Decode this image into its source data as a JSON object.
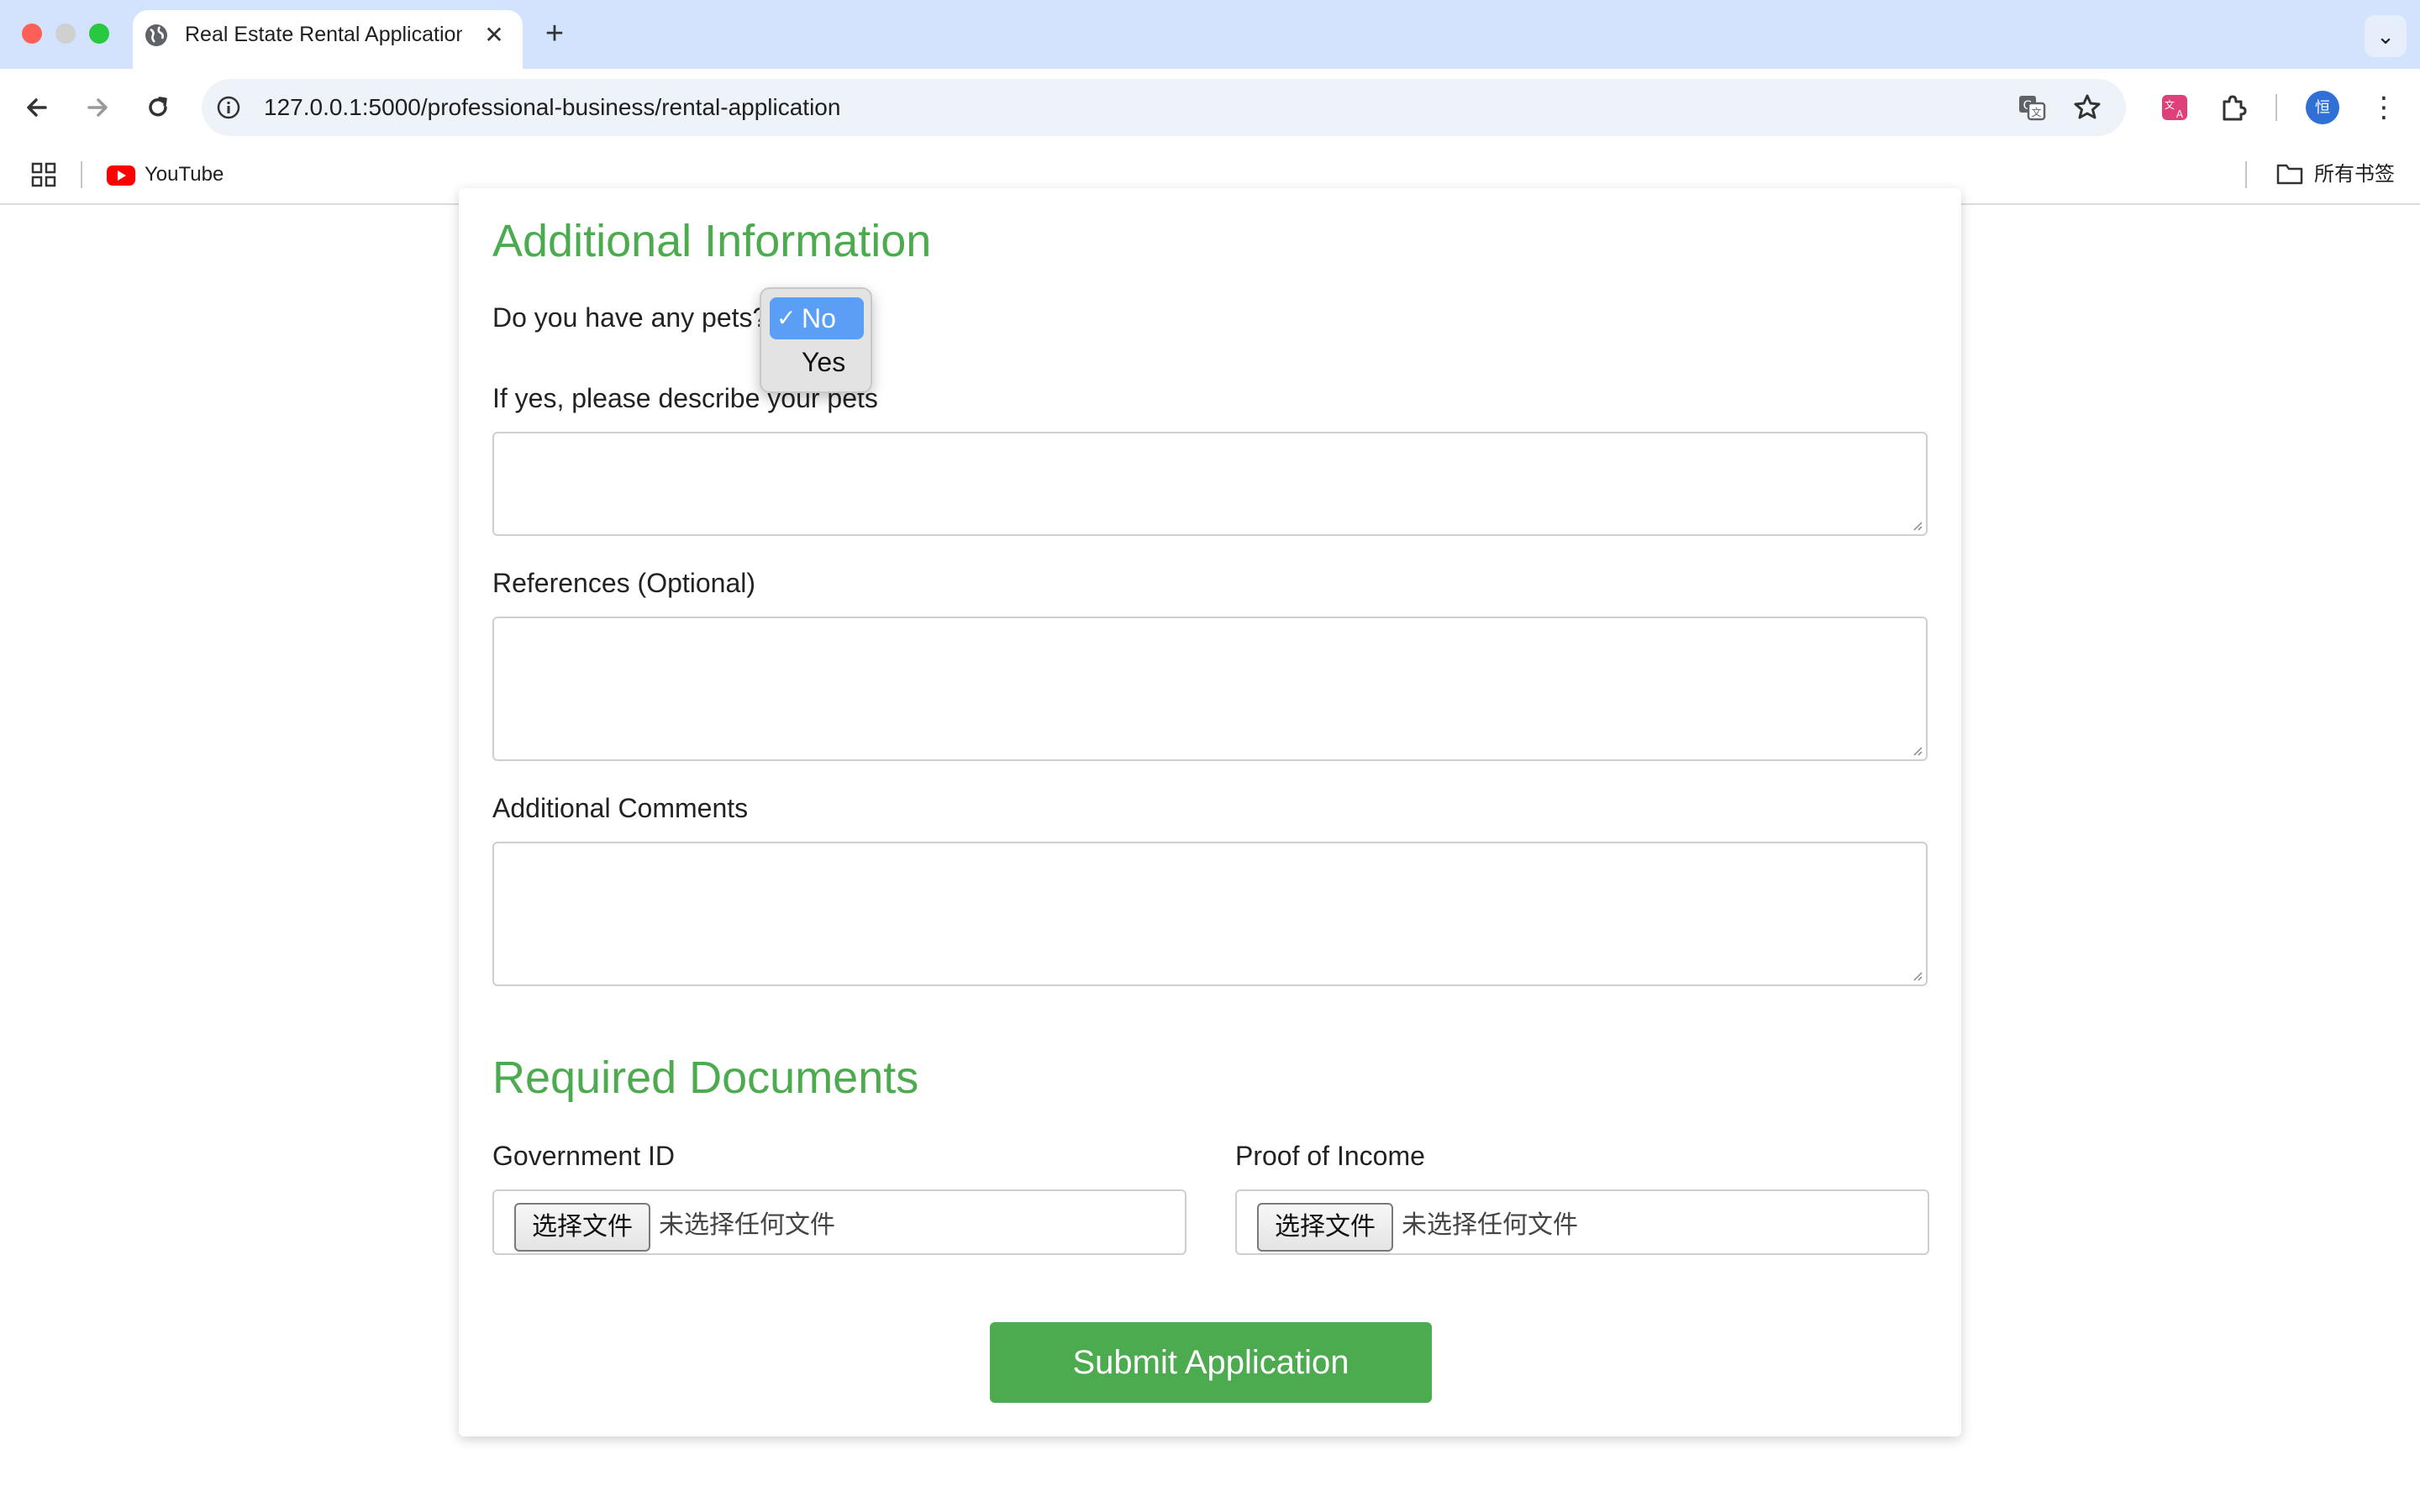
{
  "browser": {
    "tab_title": "Real Estate Rental Application",
    "url": "127.0.0.1:5000/professional-business/rental-application",
    "bookmarks": [
      {
        "label": "YouTube"
      }
    ],
    "all_bookmarks_label": "所有书签",
    "avatar_text": "恒",
    "new_tab_symbol": "+",
    "close_symbol": "✕",
    "menu_symbol": "⌄",
    "kebab_symbol": "⋮"
  },
  "colors": {
    "accent": "#4caa4f",
    "select_highlight": "#5b9ef5"
  },
  "additional_info": {
    "heading": "Additional Information",
    "pets_label": "Do you have any pets?",
    "pets_options": [
      {
        "label": "No",
        "selected": true
      },
      {
        "label": "Yes",
        "selected": false
      }
    ],
    "pets_describe_label": "If yes, please describe your pets",
    "references_label": "References (Optional)",
    "comments_label": "Additional Comments"
  },
  "required_documents": {
    "heading": "Required Documents",
    "government_id_label": "Government ID",
    "proof_of_income_label": "Proof of Income",
    "choose_file_label": "选择文件",
    "no_file_label": "未选择任何文件"
  },
  "submit_label": "Submit Application"
}
